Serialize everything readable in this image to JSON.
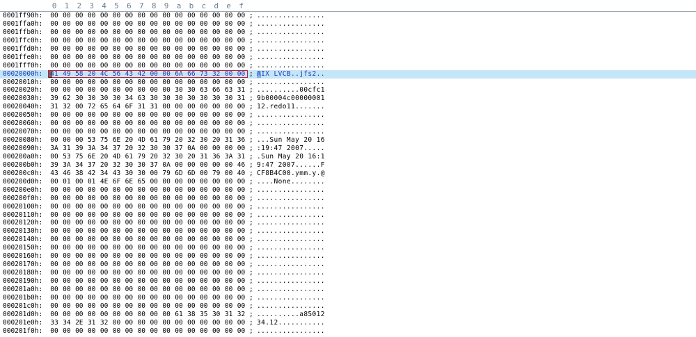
{
  "header_columns": [
    "0",
    "1",
    "2",
    "3",
    "4",
    "5",
    "6",
    "7",
    "8",
    "9",
    "a",
    "b",
    "c",
    "d",
    "e",
    "f"
  ],
  "selected_row": 7,
  "rows": [
    {
      "addr": "0001ff90h:",
      "bytes": [
        "00",
        "00",
        "00",
        "00",
        "00",
        "00",
        "00",
        "00",
        "00",
        "00",
        "00",
        "00",
        "00",
        "00",
        "00",
        "00"
      ],
      "ascii": "................"
    },
    {
      "addr": "0001ffa0h:",
      "bytes": [
        "00",
        "00",
        "00",
        "00",
        "00",
        "00",
        "00",
        "00",
        "00",
        "00",
        "00",
        "00",
        "00",
        "00",
        "00",
        "00"
      ],
      "ascii": "................"
    },
    {
      "addr": "0001ffb0h:",
      "bytes": [
        "00",
        "00",
        "00",
        "00",
        "00",
        "00",
        "00",
        "00",
        "00",
        "00",
        "00",
        "00",
        "00",
        "00",
        "00",
        "00"
      ],
      "ascii": "................"
    },
    {
      "addr": "0001ffc0h:",
      "bytes": [
        "00",
        "00",
        "00",
        "00",
        "00",
        "00",
        "00",
        "00",
        "00",
        "00",
        "00",
        "00",
        "00",
        "00",
        "00",
        "00"
      ],
      "ascii": "................"
    },
    {
      "addr": "0001ffd0h:",
      "bytes": [
        "00",
        "00",
        "00",
        "00",
        "00",
        "00",
        "00",
        "00",
        "00",
        "00",
        "00",
        "00",
        "00",
        "00",
        "00",
        "00"
      ],
      "ascii": "................"
    },
    {
      "addr": "0001ffe0h:",
      "bytes": [
        "00",
        "00",
        "00",
        "00",
        "00",
        "00",
        "00",
        "00",
        "00",
        "00",
        "00",
        "00",
        "00",
        "00",
        "00",
        "00"
      ],
      "ascii": "................"
    },
    {
      "addr": "0001fff0h:",
      "bytes": [
        "00",
        "00",
        "00",
        "00",
        "00",
        "00",
        "00",
        "00",
        "00",
        "00",
        "00",
        "00",
        "00",
        "00",
        "00",
        "00"
      ],
      "ascii": "................"
    },
    {
      "addr": "00020000h:",
      "bytes": [
        "41",
        "49",
        "58",
        "20",
        "4C",
        "56",
        "43",
        "42",
        "00",
        "00",
        "6A",
        "66",
        "73",
        "32",
        "00",
        "00"
      ],
      "ascii": "AIX LVCB..jfs2.."
    },
    {
      "addr": "00020010h:",
      "bytes": [
        "00",
        "00",
        "00",
        "00",
        "00",
        "00",
        "00",
        "00",
        "00",
        "00",
        "00",
        "00",
        "00",
        "00",
        "00",
        "00"
      ],
      "ascii": "................"
    },
    {
      "addr": "00020020h:",
      "bytes": [
        "00",
        "00",
        "00",
        "00",
        "00",
        "00",
        "00",
        "00",
        "00",
        "00",
        "30",
        "30",
        "63",
        "66",
        "63",
        "31"
      ],
      "ascii": "..........00cfc1"
    },
    {
      "addr": "00020030h:",
      "bytes": [
        "39",
        "62",
        "30",
        "30",
        "30",
        "30",
        "34",
        "63",
        "30",
        "30",
        "30",
        "30",
        "30",
        "30",
        "30",
        "31"
      ],
      "ascii": "9b00004c00000001"
    },
    {
      "addr": "00020040h:",
      "bytes": [
        "31",
        "32",
        "00",
        "72",
        "65",
        "64",
        "6F",
        "31",
        "31",
        "00",
        "00",
        "00",
        "00",
        "00",
        "00",
        "00"
      ],
      "ascii": "12.redo11......."
    },
    {
      "addr": "00020050h:",
      "bytes": [
        "00",
        "00",
        "00",
        "00",
        "00",
        "00",
        "00",
        "00",
        "00",
        "00",
        "00",
        "00",
        "00",
        "00",
        "00",
        "00"
      ],
      "ascii": "................"
    },
    {
      "addr": "00020060h:",
      "bytes": [
        "00",
        "00",
        "00",
        "00",
        "00",
        "00",
        "00",
        "00",
        "00",
        "00",
        "00",
        "00",
        "00",
        "00",
        "00",
        "00"
      ],
      "ascii": "................"
    },
    {
      "addr": "00020070h:",
      "bytes": [
        "00",
        "00",
        "00",
        "00",
        "00",
        "00",
        "00",
        "00",
        "00",
        "00",
        "00",
        "00",
        "00",
        "00",
        "00",
        "00"
      ],
      "ascii": "................"
    },
    {
      "addr": "00020080h:",
      "bytes": [
        "00",
        "00",
        "00",
        "53",
        "75",
        "6E",
        "20",
        "4D",
        "61",
        "79",
        "20",
        "32",
        "30",
        "20",
        "31",
        "36"
      ],
      "ascii": "...Sun May 20 16"
    },
    {
      "addr": "00020090h:",
      "bytes": [
        "3A",
        "31",
        "39",
        "3A",
        "34",
        "37",
        "20",
        "32",
        "30",
        "30",
        "37",
        "0A",
        "00",
        "00",
        "00",
        "00"
      ],
      "ascii": ":19:47 2007....."
    },
    {
      "addr": "000200a0h:",
      "bytes": [
        "00",
        "53",
        "75",
        "6E",
        "20",
        "4D",
        "61",
        "79",
        "20",
        "32",
        "30",
        "20",
        "31",
        "36",
        "3A",
        "31"
      ],
      "ascii": ".Sun May 20 16:1"
    },
    {
      "addr": "000200b0h:",
      "bytes": [
        "39",
        "3A",
        "34",
        "37",
        "20",
        "32",
        "30",
        "30",
        "37",
        "0A",
        "00",
        "00",
        "00",
        "00",
        "00",
        "46"
      ],
      "ascii": "9:47 2007......F"
    },
    {
      "addr": "000200c0h:",
      "bytes": [
        "43",
        "46",
        "38",
        "42",
        "34",
        "43",
        "30",
        "30",
        "00",
        "79",
        "6D",
        "6D",
        "00",
        "79",
        "00",
        "40"
      ],
      "ascii": "CF8B4C00.ymm.y.@"
    },
    {
      "addr": "000200d0h:",
      "bytes": [
        "00",
        "01",
        "00",
        "01",
        "4E",
        "6F",
        "6E",
        "65",
        "00",
        "00",
        "00",
        "00",
        "00",
        "00",
        "00",
        "00"
      ],
      "ascii": "....None........"
    },
    {
      "addr": "000200e0h:",
      "bytes": [
        "00",
        "00",
        "00",
        "00",
        "00",
        "00",
        "00",
        "00",
        "00",
        "00",
        "00",
        "00",
        "00",
        "00",
        "00",
        "00"
      ],
      "ascii": "................"
    },
    {
      "addr": "000200f0h:",
      "bytes": [
        "00",
        "00",
        "00",
        "00",
        "00",
        "00",
        "00",
        "00",
        "00",
        "00",
        "00",
        "00",
        "00",
        "00",
        "00",
        "00"
      ],
      "ascii": "................"
    },
    {
      "addr": "00020100h:",
      "bytes": [
        "00",
        "00",
        "00",
        "00",
        "00",
        "00",
        "00",
        "00",
        "00",
        "00",
        "00",
        "00",
        "00",
        "00",
        "00",
        "00"
      ],
      "ascii": "................"
    },
    {
      "addr": "00020110h:",
      "bytes": [
        "00",
        "00",
        "00",
        "00",
        "00",
        "00",
        "00",
        "00",
        "00",
        "00",
        "00",
        "00",
        "00",
        "00",
        "00",
        "00"
      ],
      "ascii": "................"
    },
    {
      "addr": "00020120h:",
      "bytes": [
        "00",
        "00",
        "00",
        "00",
        "00",
        "00",
        "00",
        "00",
        "00",
        "00",
        "00",
        "00",
        "00",
        "00",
        "00",
        "00"
      ],
      "ascii": "................"
    },
    {
      "addr": "00020130h:",
      "bytes": [
        "00",
        "00",
        "00",
        "00",
        "00",
        "00",
        "00",
        "00",
        "00",
        "00",
        "00",
        "00",
        "00",
        "00",
        "00",
        "00"
      ],
      "ascii": "................"
    },
    {
      "addr": "00020140h:",
      "bytes": [
        "00",
        "00",
        "00",
        "00",
        "00",
        "00",
        "00",
        "00",
        "00",
        "00",
        "00",
        "00",
        "00",
        "00",
        "00",
        "00"
      ],
      "ascii": "................"
    },
    {
      "addr": "00020150h:",
      "bytes": [
        "00",
        "00",
        "00",
        "00",
        "00",
        "00",
        "00",
        "00",
        "00",
        "00",
        "00",
        "00",
        "00",
        "00",
        "00",
        "00"
      ],
      "ascii": "................"
    },
    {
      "addr": "00020160h:",
      "bytes": [
        "00",
        "00",
        "00",
        "00",
        "00",
        "00",
        "00",
        "00",
        "00",
        "00",
        "00",
        "00",
        "00",
        "00",
        "00",
        "00"
      ],
      "ascii": "................"
    },
    {
      "addr": "00020170h:",
      "bytes": [
        "00",
        "00",
        "00",
        "00",
        "00",
        "00",
        "00",
        "00",
        "00",
        "00",
        "00",
        "00",
        "00",
        "00",
        "00",
        "00"
      ],
      "ascii": "................"
    },
    {
      "addr": "00020180h:",
      "bytes": [
        "00",
        "00",
        "00",
        "00",
        "00",
        "00",
        "00",
        "00",
        "00",
        "00",
        "00",
        "00",
        "00",
        "00",
        "00",
        "00"
      ],
      "ascii": "................"
    },
    {
      "addr": "00020190h:",
      "bytes": [
        "00",
        "00",
        "00",
        "00",
        "00",
        "00",
        "00",
        "00",
        "00",
        "00",
        "00",
        "00",
        "00",
        "00",
        "00",
        "00"
      ],
      "ascii": "................"
    },
    {
      "addr": "000201a0h:",
      "bytes": [
        "00",
        "00",
        "00",
        "00",
        "00",
        "00",
        "00",
        "00",
        "00",
        "00",
        "00",
        "00",
        "00",
        "00",
        "00",
        "00"
      ],
      "ascii": "................"
    },
    {
      "addr": "000201b0h:",
      "bytes": [
        "00",
        "00",
        "00",
        "00",
        "00",
        "00",
        "00",
        "00",
        "00",
        "00",
        "00",
        "00",
        "00",
        "00",
        "00",
        "00"
      ],
      "ascii": "................"
    },
    {
      "addr": "000201c0h:",
      "bytes": [
        "00",
        "00",
        "00",
        "00",
        "00",
        "00",
        "00",
        "00",
        "00",
        "00",
        "00",
        "00",
        "00",
        "00",
        "00",
        "00"
      ],
      "ascii": "................"
    },
    {
      "addr": "000201d0h:",
      "bytes": [
        "00",
        "00",
        "00",
        "00",
        "00",
        "00",
        "00",
        "00",
        "00",
        "00",
        "61",
        "38",
        "35",
        "30",
        "31",
        "32"
      ],
      "ascii": "..........a85012"
    },
    {
      "addr": "000201e0h:",
      "bytes": [
        "33",
        "34",
        "2E",
        "31",
        "32",
        "00",
        "00",
        "00",
        "00",
        "00",
        "00",
        "00",
        "00",
        "00",
        "00",
        "00"
      ],
      "ascii": "34.12..........."
    },
    {
      "addr": "000201f0h:",
      "bytes": [
        "00",
        "00",
        "00",
        "00",
        "00",
        "00",
        "00",
        "00",
        "00",
        "00",
        "00",
        "00",
        "00",
        "00",
        "00",
        "00"
      ],
      "ascii": "................"
    }
  ]
}
